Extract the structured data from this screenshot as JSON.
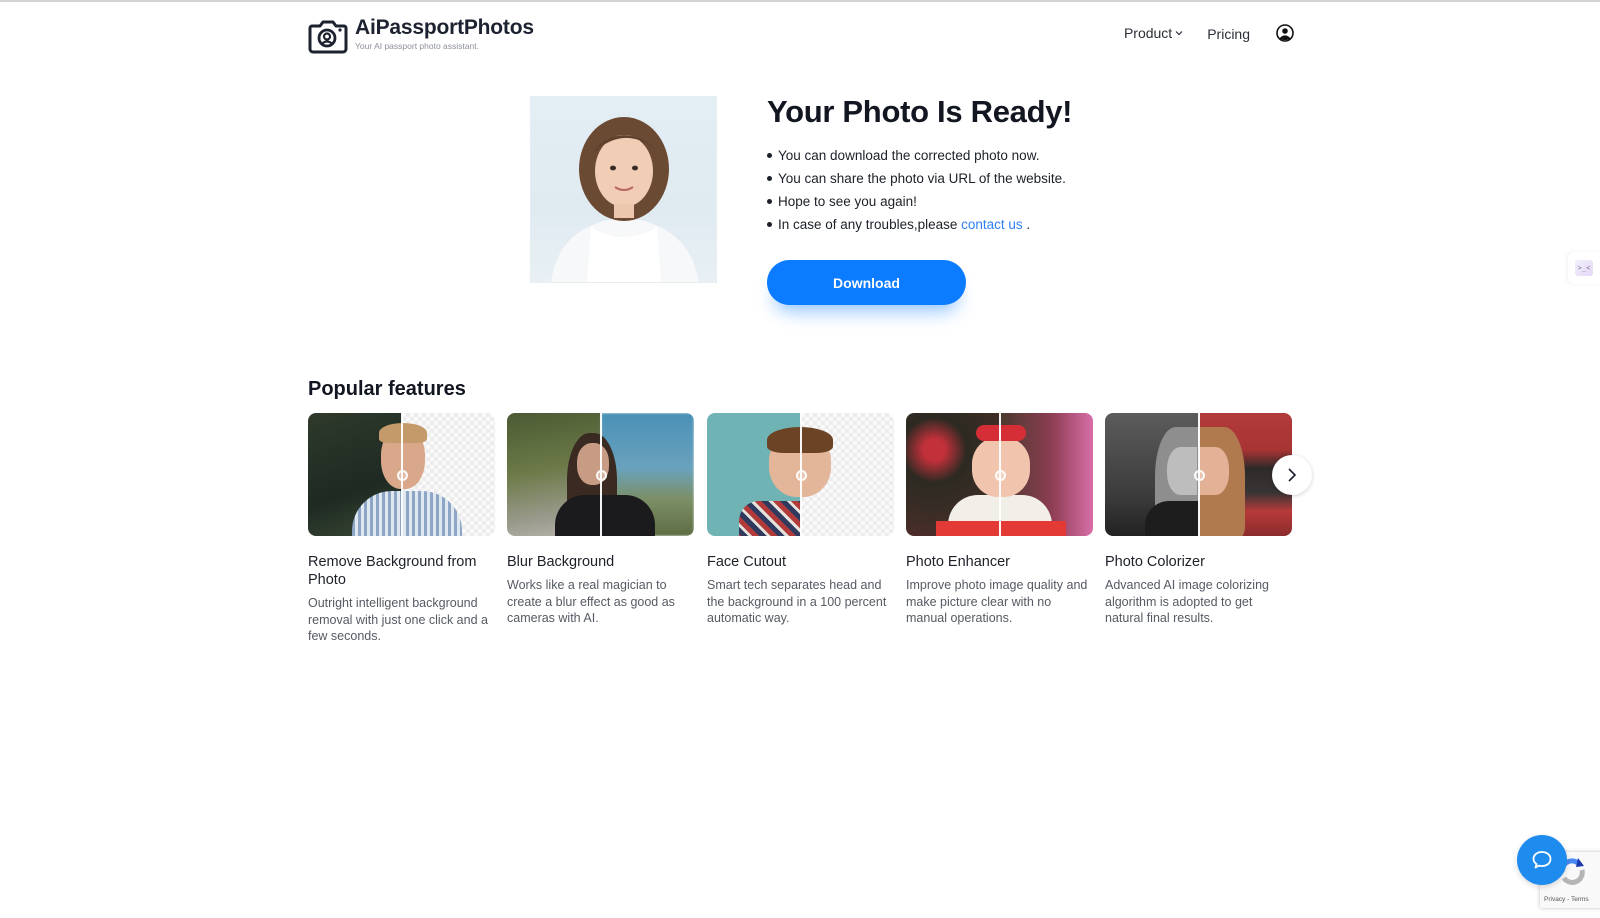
{
  "header": {
    "brand_name": "AiPassportPhotos",
    "brand_tagline": "Your AI passport photo assistant.",
    "logo_icon": "camera-face-icon",
    "nav": {
      "product_label": "Product",
      "product_icon": "chevron-down-icon",
      "pricing_label": "Pricing",
      "account_icon": "user-circle-icon"
    }
  },
  "hero": {
    "photo_alt": "Corrected passport photo of a smiling girl",
    "title": "Your Photo Is Ready!",
    "bullets": [
      "You can download the corrected photo now.",
      "You can share the photo via URL of the website.",
      "Hope to see you again!"
    ],
    "trouble_prefix": "In case of any troubles,please ",
    "contact_link_label": "contact us",
    "trouble_suffix": " .",
    "download_label": "Download"
  },
  "features": {
    "title": "Popular features",
    "next_icon": "chevron-right-icon",
    "cards": [
      {
        "title": "Remove Background from Photo",
        "description": "Outright intelligent background removal with just one click and a few seconds."
      },
      {
        "title": "Blur Background",
        "description": "Works like a real magician to create a blur effect as good as cameras with AI."
      },
      {
        "title": "Face Cutout",
        "description": "Smart tech separates head and the background in a 100 percent automatic way."
      },
      {
        "title": "Photo Enhancer",
        "description": "Improve photo image quality and make picture clear with no manual operations."
      },
      {
        "title": "Photo Colorizer",
        "description": "Advanced AI image colorizing algorithm is adopted to get natural final results."
      }
    ]
  },
  "widgets": {
    "side_widget_text": ">_<",
    "chat_icon": "chat-bubble-icon",
    "recaptcha_links": "Privacy - Terms"
  },
  "colors": {
    "primary": "#0b7bff",
    "link": "#2f7ff5",
    "chat": "#1e8bef",
    "text": "#121620"
  }
}
